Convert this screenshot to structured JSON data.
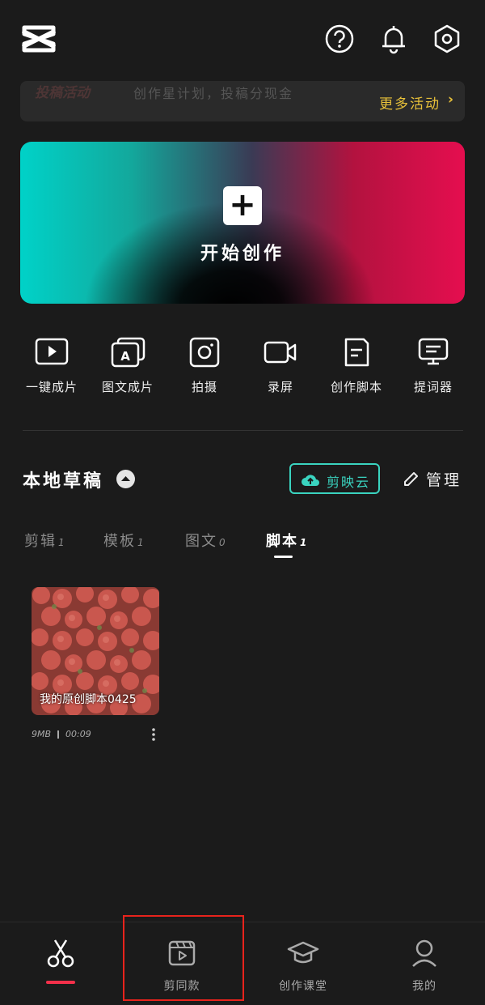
{
  "header": {
    "logo": "capcut-logo-icon",
    "icons": [
      "help-icon",
      "bell-icon",
      "settings-icon"
    ]
  },
  "banner": {
    "tag": "投稿活动",
    "subtitle": "创作星计划，投稿分现金",
    "more_label": "更多活动",
    "chevron": "›"
  },
  "hero": {
    "plus": "+",
    "title": "开始创作"
  },
  "tools": [
    {
      "icon": "play-icon",
      "label": "一键成片"
    },
    {
      "icon": "image-text-icon",
      "label": "图文成片"
    },
    {
      "icon": "camera-icon",
      "label": "拍摄"
    },
    {
      "icon": "video-camera-icon",
      "label": "录屏"
    },
    {
      "icon": "script-icon",
      "label": "创作脚本"
    },
    {
      "icon": "teleprompter-icon",
      "label": "提词器"
    }
  ],
  "drafts": {
    "title": "本地草稿",
    "cloud_label": "剪映云",
    "manage_label": "管理",
    "tabs": [
      {
        "label": "剪辑",
        "count": "1"
      },
      {
        "label": "模板",
        "count": "1"
      },
      {
        "label": "图文",
        "count": "0"
      },
      {
        "label": "脚本",
        "count": "1"
      }
    ],
    "active_tab": "脚本",
    "items": [
      {
        "title": "我的原创脚本0425",
        "size": "9MB",
        "duration": "00:09"
      }
    ]
  },
  "nav": {
    "items": [
      {
        "icon": "scissors-icon",
        "label": ""
      },
      {
        "icon": "template-icon",
        "label": "剪同款"
      },
      {
        "icon": "graduation-cap-icon",
        "label": "创作课堂"
      },
      {
        "icon": "user-icon",
        "label": "我的"
      }
    ],
    "accent": "#f3304a",
    "highlight_color": "#e8231c"
  },
  "colors": {
    "background": "#1b1b1b",
    "cloud_accent": "#3ad4c0",
    "banner_accent": "#e8c13a"
  }
}
